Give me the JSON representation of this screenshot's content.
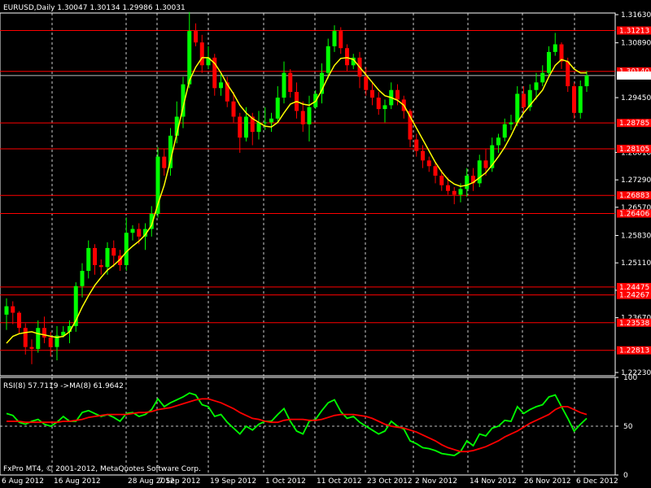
{
  "window": {
    "header": "EURUSD,Daily  1.30047 1.30134 1.29986 1.30031",
    "footer": "FxPro MT4, © 2001-2012, MetaQuotes Software Corp."
  },
  "colors": {
    "background": "#000000",
    "bull": "#00ff00",
    "bear": "#ff0000",
    "ma": "#ffff00",
    "hline": "#ff0000",
    "grid": "#ffffff",
    "rsi": "#00ff00",
    "rsi_ma": "#ff0000",
    "label_bg": "#ff0000"
  },
  "chart_data": [
    {
      "type": "candlestick",
      "symbol": "EURUSD",
      "timeframe": "Daily",
      "ohlc_display": "1.30047 1.30134 1.29986 1.30031",
      "current_price": "1.30031",
      "ylim": [
        1.2223,
        1.3163
      ],
      "y_ticks": [
        "1.31630",
        "1.30890",
        "1.29450",
        "1.28010",
        "1.27290",
        "1.26570",
        "1.25830",
        "1.25110",
        "1.24390",
        "1.23670",
        "1.22230"
      ],
      "x_ticks": [
        "6 Aug 2012",
        "16 Aug 2012",
        "28 Aug 2012",
        "7 Sep 2012",
        "19 Sep 2012",
        "1 Oct 2012",
        "11 Oct 2012",
        "23 Oct 2012",
        "2 Nov 2012",
        "14 Nov 2012",
        "26 Nov 2012",
        "6 Dec 2012"
      ],
      "horizontal_levels": [
        "1.31213",
        "1.30140",
        "1.28785",
        "1.28105",
        "1.26883",
        "1.26406",
        "1.24475",
        "1.24267",
        "1.23538",
        "1.22813"
      ],
      "candles": [
        {
          "date": "2012-08-06",
          "o": 1.2375,
          "h": 1.2418,
          "l": 1.2335,
          "c": 1.2397
        },
        {
          "date": "2012-08-07",
          "o": 1.2397,
          "h": 1.241,
          "l": 1.235,
          "c": 1.238
        },
        {
          "date": "2012-08-08",
          "o": 1.238,
          "h": 1.2384,
          "l": 1.2325,
          "c": 1.234
        },
        {
          "date": "2012-08-09",
          "o": 1.234,
          "h": 1.2352,
          "l": 1.227,
          "c": 1.229
        },
        {
          "date": "2012-08-10",
          "o": 1.229,
          "h": 1.231,
          "l": 1.2245,
          "c": 1.2285
        },
        {
          "date": "2012-08-13",
          "o": 1.2285,
          "h": 1.236,
          "l": 1.2275,
          "c": 1.234
        },
        {
          "date": "2012-08-14",
          "o": 1.234,
          "h": 1.237,
          "l": 1.23,
          "c": 1.2315
        },
        {
          "date": "2012-08-15",
          "o": 1.2315,
          "h": 1.233,
          "l": 1.2265,
          "c": 1.229
        },
        {
          "date": "2012-08-16",
          "o": 1.229,
          "h": 1.2345,
          "l": 1.2255,
          "c": 1.232
        },
        {
          "date": "2012-08-17",
          "o": 1.232,
          "h": 1.2345,
          "l": 1.2315,
          "c": 1.233
        },
        {
          "date": "2012-08-20",
          "o": 1.233,
          "h": 1.236,
          "l": 1.23,
          "c": 1.2345
        },
        {
          "date": "2012-08-21",
          "o": 1.2345,
          "h": 1.246,
          "l": 1.233,
          "c": 1.245
        },
        {
          "date": "2012-08-22",
          "o": 1.245,
          "h": 1.251,
          "l": 1.242,
          "c": 1.249
        },
        {
          "date": "2012-08-23",
          "o": 1.249,
          "h": 1.257,
          "l": 1.247,
          "c": 1.255
        },
        {
          "date": "2012-08-24",
          "o": 1.255,
          "h": 1.256,
          "l": 1.248,
          "c": 1.2505
        },
        {
          "date": "2012-08-27",
          "o": 1.2505,
          "h": 1.252,
          "l": 1.248,
          "c": 1.25
        },
        {
          "date": "2012-08-28",
          "o": 1.25,
          "h": 1.2565,
          "l": 1.248,
          "c": 1.255
        },
        {
          "date": "2012-08-29",
          "o": 1.255,
          "h": 1.257,
          "l": 1.25,
          "c": 1.253
        },
        {
          "date": "2012-08-30",
          "o": 1.253,
          "h": 1.2545,
          "l": 1.249,
          "c": 1.2505
        },
        {
          "date": "2012-08-31",
          "o": 1.2505,
          "h": 1.263,
          "l": 1.249,
          "c": 1.259
        },
        {
          "date": "2012-09-03",
          "o": 1.259,
          "h": 1.261,
          "l": 1.257,
          "c": 1.26
        },
        {
          "date": "2012-09-04",
          "o": 1.26,
          "h": 1.2615,
          "l": 1.256,
          "c": 1.258
        },
        {
          "date": "2012-09-05",
          "o": 1.258,
          "h": 1.2615,
          "l": 1.2545,
          "c": 1.26
        },
        {
          "date": "2012-09-06",
          "o": 1.26,
          "h": 1.266,
          "l": 1.258,
          "c": 1.264
        },
        {
          "date": "2012-09-07",
          "o": 1.264,
          "h": 1.2815,
          "l": 1.263,
          "c": 1.279
        },
        {
          "date": "2012-09-10",
          "o": 1.279,
          "h": 1.281,
          "l": 1.274,
          "c": 1.276
        },
        {
          "date": "2012-09-11",
          "o": 1.276,
          "h": 1.2865,
          "l": 1.274,
          "c": 1.2845
        },
        {
          "date": "2012-09-12",
          "o": 1.2845,
          "h": 1.2935,
          "l": 1.2825,
          "c": 1.2895
        },
        {
          "date": "2012-09-13",
          "o": 1.2895,
          "h": 1.3,
          "l": 1.2865,
          "c": 1.298
        },
        {
          "date": "2012-09-14",
          "o": 1.298,
          "h": 1.317,
          "l": 1.297,
          "c": 1.312
        },
        {
          "date": "2012-09-17",
          "o": 1.312,
          "h": 1.314,
          "l": 1.308,
          "c": 1.309
        },
        {
          "date": "2012-09-18",
          "o": 1.309,
          "h": 1.311,
          "l": 1.301,
          "c": 1.303
        },
        {
          "date": "2012-09-19",
          "o": 1.303,
          "h": 1.308,
          "l": 1.302,
          "c": 1.305
        },
        {
          "date": "2012-09-20",
          "o": 1.305,
          "h": 1.306,
          "l": 1.295,
          "c": 1.297
        },
        {
          "date": "2012-09-21",
          "o": 1.297,
          "h": 1.301,
          "l": 1.295,
          "c": 1.2985
        },
        {
          "date": "2012-09-24",
          "o": 1.2985,
          "h": 1.3,
          "l": 1.292,
          "c": 1.2935
        },
        {
          "date": "2012-09-25",
          "o": 1.2935,
          "h": 1.296,
          "l": 1.288,
          "c": 1.2895
        },
        {
          "date": "2012-09-26",
          "o": 1.2895,
          "h": 1.2905,
          "l": 1.28,
          "c": 1.284
        },
        {
          "date": "2012-09-27",
          "o": 1.284,
          "h": 1.292,
          "l": 1.283,
          "c": 1.2895
        },
        {
          "date": "2012-09-28",
          "o": 1.2895,
          "h": 1.2905,
          "l": 1.282,
          "c": 1.2855
        },
        {
          "date": "2012-10-01",
          "o": 1.2855,
          "h": 1.291,
          "l": 1.2835,
          "c": 1.288
        },
        {
          "date": "2012-10-02",
          "o": 1.288,
          "h": 1.292,
          "l": 1.286,
          "c": 1.288
        },
        {
          "date": "2012-10-03",
          "o": 1.288,
          "h": 1.2905,
          "l": 1.2855,
          "c": 1.289
        },
        {
          "date": "2012-10-04",
          "o": 1.289,
          "h": 1.2975,
          "l": 1.288,
          "c": 1.2945
        },
        {
          "date": "2012-10-05",
          "o": 1.2945,
          "h": 1.304,
          "l": 1.293,
          "c": 1.301
        },
        {
          "date": "2012-10-08",
          "o": 1.301,
          "h": 1.302,
          "l": 1.2945,
          "c": 1.296
        },
        {
          "date": "2012-10-09",
          "o": 1.296,
          "h": 1.2985,
          "l": 1.289,
          "c": 1.291
        },
        {
          "date": "2012-10-10",
          "o": 1.291,
          "h": 1.2935,
          "l": 1.2855,
          "c": 1.2875
        },
        {
          "date": "2012-10-11",
          "o": 1.2875,
          "h": 1.295,
          "l": 1.283,
          "c": 1.292
        },
        {
          "date": "2012-10-12",
          "o": 1.292,
          "h": 1.2965,
          "l": 1.2915,
          "c": 1.2955
        },
        {
          "date": "2012-10-15",
          "o": 1.2955,
          "h": 1.3035,
          "l": 1.293,
          "c": 1.301
        },
        {
          "date": "2012-10-16",
          "o": 1.301,
          "h": 1.31,
          "l": 1.2995,
          "c": 1.308
        },
        {
          "date": "2012-10-17",
          "o": 1.308,
          "h": 1.3135,
          "l": 1.3065,
          "c": 1.312
        },
        {
          "date": "2012-10-18",
          "o": 1.312,
          "h": 1.313,
          "l": 1.306,
          "c": 1.3075
        },
        {
          "date": "2012-10-19",
          "o": 1.3075,
          "h": 1.3085,
          "l": 1.3015,
          "c": 1.303
        },
        {
          "date": "2012-10-22",
          "o": 1.303,
          "h": 1.306,
          "l": 1.302,
          "c": 1.305
        },
        {
          "date": "2012-10-23",
          "o": 1.305,
          "h": 1.3065,
          "l": 1.297,
          "c": 1.3
        },
        {
          "date": "2012-10-24",
          "o": 1.3,
          "h": 1.3025,
          "l": 1.295,
          "c": 1.2965
        },
        {
          "date": "2012-10-25",
          "o": 1.2965,
          "h": 1.2985,
          "l": 1.2925,
          "c": 1.2945
        },
        {
          "date": "2012-10-26",
          "o": 1.2945,
          "h": 1.296,
          "l": 1.29,
          "c": 1.2915
        },
        {
          "date": "2012-10-29",
          "o": 1.2915,
          "h": 1.294,
          "l": 1.288,
          "c": 1.2925
        },
        {
          "date": "2012-10-30",
          "o": 1.2925,
          "h": 1.2985,
          "l": 1.2915,
          "c": 1.2965
        },
        {
          "date": "2012-10-31",
          "o": 1.2965,
          "h": 1.298,
          "l": 1.2925,
          "c": 1.294
        },
        {
          "date": "2012-11-01",
          "o": 1.294,
          "h": 1.295,
          "l": 1.289,
          "c": 1.291
        },
        {
          "date": "2012-11-02",
          "o": 1.291,
          "h": 1.2915,
          "l": 1.2815,
          "c": 1.2835
        },
        {
          "date": "2012-11-05",
          "o": 1.2835,
          "h": 1.285,
          "l": 1.279,
          "c": 1.2805
        },
        {
          "date": "2012-11-06",
          "o": 1.2805,
          "h": 1.282,
          "l": 1.276,
          "c": 1.278
        },
        {
          "date": "2012-11-07",
          "o": 1.278,
          "h": 1.279,
          "l": 1.275,
          "c": 1.2765
        },
        {
          "date": "2012-11-08",
          "o": 1.2765,
          "h": 1.2775,
          "l": 1.272,
          "c": 1.274
        },
        {
          "date": "2012-11-09",
          "o": 1.274,
          "h": 1.2755,
          "l": 1.27,
          "c": 1.2715
        },
        {
          "date": "2012-11-12",
          "o": 1.2715,
          "h": 1.2735,
          "l": 1.269,
          "c": 1.27
        },
        {
          "date": "2012-11-13",
          "o": 1.27,
          "h": 1.271,
          "l": 1.2665,
          "c": 1.269
        },
        {
          "date": "2012-11-14",
          "o": 1.269,
          "h": 1.272,
          "l": 1.267,
          "c": 1.2705
        },
        {
          "date": "2012-11-15",
          "o": 1.2705,
          "h": 1.276,
          "l": 1.2685,
          "c": 1.274
        },
        {
          "date": "2012-11-16",
          "o": 1.274,
          "h": 1.276,
          "l": 1.27,
          "c": 1.272
        },
        {
          "date": "2012-11-19",
          "o": 1.272,
          "h": 1.2795,
          "l": 1.271,
          "c": 1.278
        },
        {
          "date": "2012-11-20",
          "o": 1.278,
          "h": 1.281,
          "l": 1.274,
          "c": 1.276
        },
        {
          "date": "2012-11-21",
          "o": 1.276,
          "h": 1.284,
          "l": 1.275,
          "c": 1.282
        },
        {
          "date": "2012-11-22",
          "o": 1.282,
          "h": 1.285,
          "l": 1.28,
          "c": 1.284
        },
        {
          "date": "2012-11-23",
          "o": 1.284,
          "h": 1.289,
          "l": 1.283,
          "c": 1.2875
        },
        {
          "date": "2012-11-26",
          "o": 1.2875,
          "h": 1.29,
          "l": 1.286,
          "c": 1.288
        },
        {
          "date": "2012-11-27",
          "o": 1.288,
          "h": 1.2975,
          "l": 1.287,
          "c": 1.2955
        },
        {
          "date": "2012-11-28",
          "o": 1.2955,
          "h": 1.2975,
          "l": 1.2905,
          "c": 1.292
        },
        {
          "date": "2012-11-29",
          "o": 1.292,
          "h": 1.298,
          "l": 1.291,
          "c": 1.2965
        },
        {
          "date": "2012-11-30",
          "o": 1.2965,
          "h": 1.301,
          "l": 1.294,
          "c": 1.2985
        },
        {
          "date": "2012-12-03",
          "o": 1.2985,
          "h": 1.303,
          "l": 1.2975,
          "c": 1.301
        },
        {
          "date": "2012-12-04",
          "o": 1.301,
          "h": 1.308,
          "l": 1.3,
          "c": 1.3065
        },
        {
          "date": "2012-12-05",
          "o": 1.3065,
          "h": 1.3115,
          "l": 1.3055,
          "c": 1.3085
        },
        {
          "date": "2012-12-06",
          "o": 1.3085,
          "h": 1.309,
          "l": 1.302,
          "c": 1.304
        },
        {
          "date": "2012-12-07",
          "o": 1.304,
          "h": 1.305,
          "l": 1.296,
          "c": 1.2975
        },
        {
          "date": "2012-12-10",
          "o": 1.2975,
          "h": 1.2985,
          "l": 1.289,
          "c": 1.2905
        },
        {
          "date": "2012-12-11",
          "o": 1.2905,
          "h": 1.299,
          "l": 1.289,
          "c": 1.2975
        },
        {
          "date": "2012-12-12",
          "o": 1.2975,
          "h": 1.3015,
          "l": 1.296,
          "c": 1.3003
        }
      ],
      "ma_line": [
        1.23,
        1.2318,
        1.2325,
        1.2328,
        1.233,
        1.2325,
        1.2322,
        1.2318,
        1.2315,
        1.2318,
        1.233,
        1.236,
        1.2395,
        1.2425,
        1.2452,
        1.2473,
        1.2492,
        1.2505,
        1.252,
        1.254,
        1.2555,
        1.2568,
        1.2585,
        1.261,
        1.2665,
        1.2715,
        1.278,
        1.285,
        1.292,
        1.299,
        1.3025,
        1.305,
        1.305,
        1.3035,
        1.301,
        1.298,
        1.2955,
        1.2925,
        1.2905,
        1.289,
        1.288,
        1.287,
        1.2868,
        1.288,
        1.2905,
        1.2928,
        1.2935,
        1.2928,
        1.2925,
        1.2935,
        1.2965,
        1.3,
        1.303,
        1.3048,
        1.305,
        1.3045,
        1.3025,
        1.3005,
        1.2985,
        1.2965,
        1.295,
        1.2945,
        1.2938,
        1.2925,
        1.2895,
        1.2865,
        1.2835,
        1.2805,
        1.2775,
        1.275,
        1.273,
        1.2718,
        1.2712,
        1.2715,
        1.2722,
        1.2735,
        1.2748,
        1.2768,
        1.279,
        1.2815,
        1.2845,
        1.288,
        1.2905,
        1.2925,
        1.2945,
        1.2965,
        1.3,
        1.303,
        1.3045,
        1.304,
        1.302,
        1.301,
        1.301
      ]
    },
    {
      "type": "line",
      "title": "RSI(8) 57.7119  ->MA(8) 61.9642",
      "ylim": [
        0,
        100
      ],
      "y_ticks": [
        "100",
        "50",
        "0"
      ],
      "level": 50,
      "series": [
        {
          "name": "RSI(8)",
          "values": [
            63,
            61,
            54,
            52,
            55,
            57,
            52,
            50,
            54,
            60,
            55,
            55,
            64,
            66,
            63,
            60,
            62,
            59,
            55,
            63,
            64,
            60,
            62,
            67,
            78,
            70,
            74,
            77,
            80,
            84,
            82,
            72,
            70,
            60,
            62,
            54,
            48,
            42,
            50,
            46,
            52,
            55,
            55,
            62,
            68,
            55,
            45,
            42,
            55,
            57,
            66,
            74,
            77,
            65,
            58,
            60,
            54,
            50,
            46,
            42,
            45,
            55,
            50,
            47,
            35,
            32,
            28,
            27,
            25,
            22,
            21,
            20,
            24,
            35,
            30,
            42,
            40,
            48,
            50,
            56,
            55,
            70,
            63,
            67,
            70,
            72,
            80,
            82,
            70,
            58,
            45,
            52,
            58
          ]
        },
        {
          "name": "MA(8)",
          "values": [
            55,
            55,
            55,
            54,
            54,
            54,
            54,
            54,
            54,
            55,
            55,
            56,
            57,
            59,
            60,
            61,
            62,
            62,
            62,
            62,
            63,
            64,
            64,
            65,
            67,
            68,
            69,
            71,
            73,
            75,
            77,
            78,
            78,
            76,
            74,
            71,
            68,
            64,
            61,
            58,
            57,
            55,
            54,
            54,
            56,
            57,
            57,
            57,
            56,
            56,
            57,
            59,
            61,
            62,
            62,
            62,
            61,
            60,
            58,
            55,
            52,
            50,
            49,
            48,
            46,
            44,
            41,
            38,
            35,
            31,
            28,
            26,
            24,
            24,
            25,
            27,
            29,
            32,
            35,
            39,
            42,
            45,
            49,
            53,
            56,
            59,
            62,
            67,
            70,
            70,
            67,
            64,
            62
          ]
        }
      ]
    }
  ]
}
